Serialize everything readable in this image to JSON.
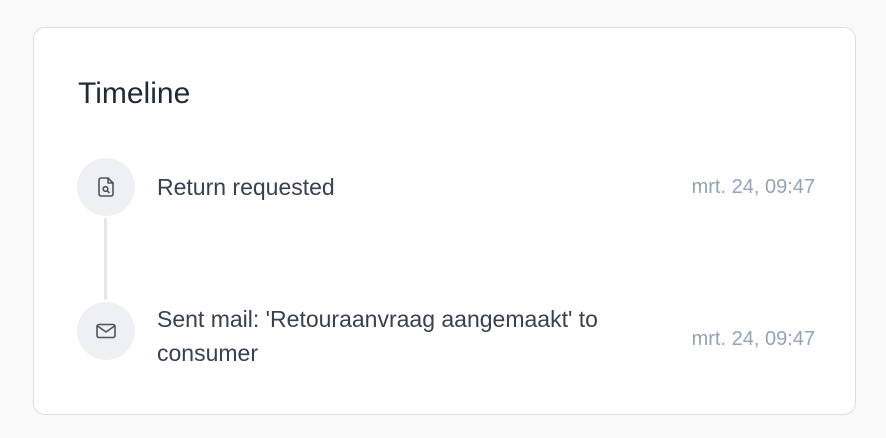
{
  "timeline": {
    "title": "Timeline",
    "events": [
      {
        "icon": "file-search-icon",
        "text": "Return requested",
        "time": "mrt. 24, 09:47"
      },
      {
        "icon": "mail-icon",
        "text": "Sent mail: 'Retouraanvraag aangemaakt' to consumer",
        "time": "mrt. 24, 09:47"
      }
    ]
  }
}
